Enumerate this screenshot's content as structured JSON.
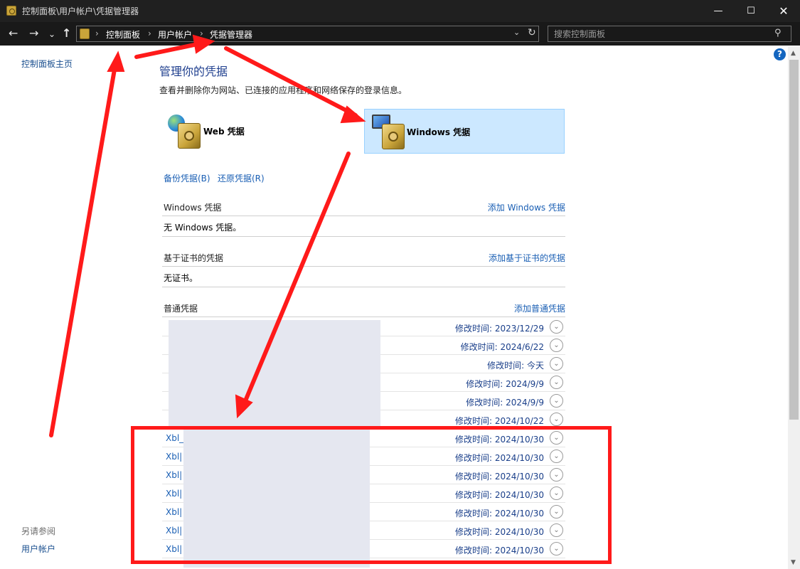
{
  "window": {
    "title": "控制面板\\用户帐户\\凭据管理器",
    "minimize_symbol": "—",
    "maximize_symbol": "☐",
    "close_symbol": "✕"
  },
  "nav": {
    "back_symbol": "←",
    "forward_symbol": "→",
    "recent_symbol": "⌄",
    "up_symbol": "↑",
    "breadcrumb_sep": "›",
    "breadcrumbs": [
      "控制面板",
      "用户帐户",
      "凭据管理器"
    ],
    "dropdown_symbol": "⌄",
    "refresh_symbol": "↻",
    "search_placeholder": "搜索控制面板",
    "search_symbol": "⚲"
  },
  "sidebar": {
    "home_link": "控制面板主页",
    "see_also": "另请参阅",
    "user_accounts_link": "用户帐户"
  },
  "help_symbol": "?",
  "main": {
    "heading": "管理你的凭据",
    "subtitle": "查看并删除你为网站、已连接的应用程序和网络保存的登录信息。",
    "tiles": {
      "web": "Web 凭据",
      "windows": "Windows 凭据"
    },
    "backup_link": "备份凭据(B)",
    "restore_link": "还原凭据(R)",
    "windows_section": {
      "title": "Windows 凭据",
      "add": "添加 Windows 凭据",
      "empty": "无 Windows 凭据。"
    },
    "cert_section": {
      "title": "基于证书的凭据",
      "add": "添加基于证书的凭据",
      "empty": "无证书。"
    },
    "generic_section": {
      "title": "普通凭据",
      "add": "添加普通凭据",
      "chevron_symbol": "⌄",
      "rows": [
        {
          "name": "",
          "modified": "修改时间:  2023/12/29"
        },
        {
          "name": "",
          "modified": "修改时间:  2024/6/22"
        },
        {
          "name": "",
          "modified": "修改时间:  今天"
        },
        {
          "name": "",
          "modified": "修改时间:  2024/9/9"
        },
        {
          "name": "",
          "modified": "修改时间:  2024/9/9"
        },
        {
          "name": "",
          "modified": "修改时间:  2024/10/22"
        },
        {
          "name": "Xbl_",
          "modified": "修改时间:  2024/10/30"
        },
        {
          "name": "Xbl|",
          "modified": "修改时间:  2024/10/30"
        },
        {
          "name": "Xbl|",
          "modified": "修改时间:  2024/10/30"
        },
        {
          "name": "Xbl|",
          "modified": "修改时间:  2024/10/30"
        },
        {
          "name": "Xbl|",
          "modified": "修改时间:  2024/10/30"
        },
        {
          "name": "Xbl|",
          "modified": "修改时间:  2024/10/30"
        },
        {
          "name": "Xbl|",
          "modified": "修改时间:  2024/10/30"
        }
      ]
    }
  },
  "colors": {
    "annotation_red": "#ff1a1a",
    "link_blue": "#1a5fb4",
    "selected_tile": "#cce8ff"
  }
}
